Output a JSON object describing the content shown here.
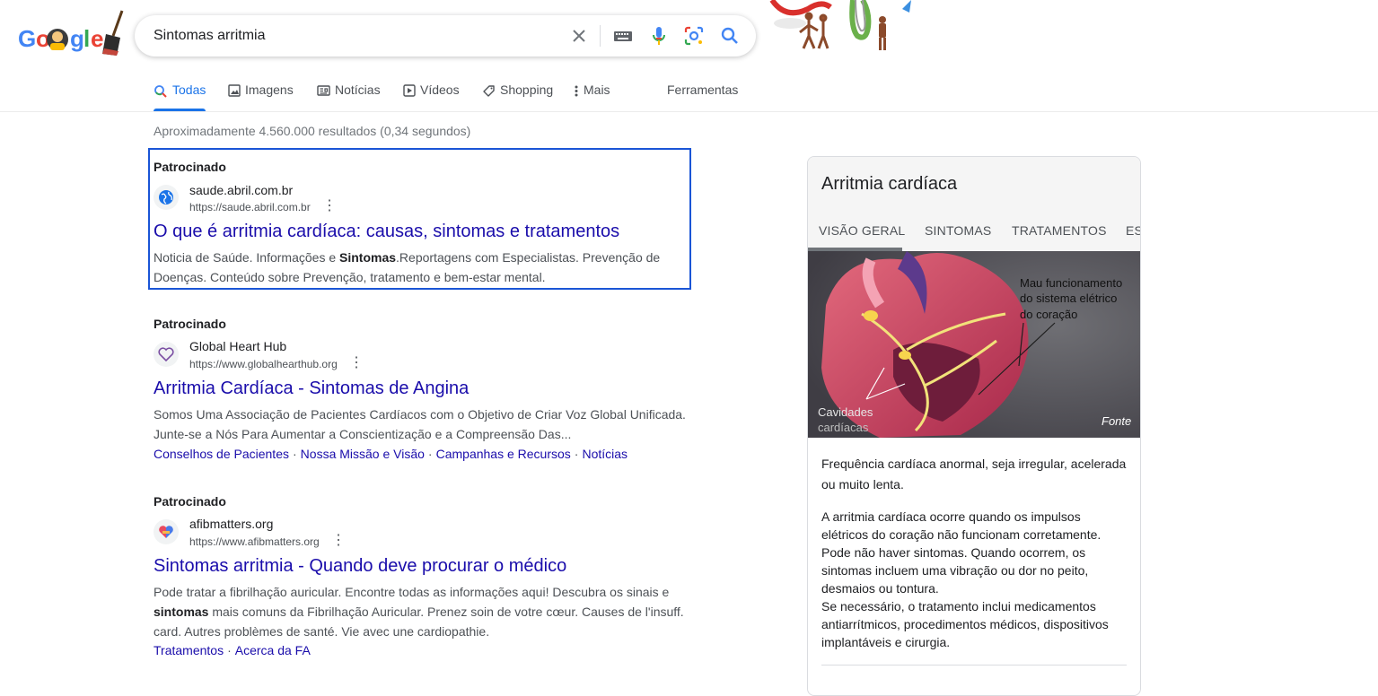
{
  "search": {
    "query": "Sintomas arritmia"
  },
  "logo": {
    "letters": [
      "G",
      "o",
      "o",
      "g",
      "l",
      "e"
    ],
    "colors": [
      "#4285f4",
      "#ea4335",
      "#fbbc05",
      "#4285f4",
      "#34a853",
      "#ea4335"
    ]
  },
  "tabs": [
    {
      "label": "Todas",
      "icon": "search-icon"
    },
    {
      "label": "Imagens",
      "icon": "image-icon"
    },
    {
      "label": "Notícias",
      "icon": "news-icon"
    },
    {
      "label": "Vídeos",
      "icon": "play-icon"
    },
    {
      "label": "Shopping",
      "icon": "tag-icon"
    },
    {
      "label": "Mais",
      "icon": "more-vert-icon"
    }
  ],
  "tools_label": "Ferramentas",
  "result_stats": "Aproximadamente 4.560.000 resultados (0,34 segundos)",
  "ads": [
    {
      "sponsored": "Patrocinado",
      "site_name": "saude.abril.com.br",
      "url": "https://saude.abril.com.br",
      "title": "O que é arritmia cardíaca: causas, sintomas e tratamentos",
      "desc_line1_a": "Noticia de Saúde. Informações e ",
      "desc_line1_b": "Sintomas",
      "desc_line1_c": ".Reportagens com Especialistas. Prevenção de",
      "desc_line2": "Doenças. Conteúdo sobre Prevenção, tratamento e bem-estar mental."
    },
    {
      "sponsored": "Patrocinado",
      "site_name": "Global Heart Hub",
      "url": "https://www.globalhearthub.org",
      "title": "Arritmia Cardíaca - Sintomas de Angina",
      "desc_line1": "Somos Uma Associação de Pacientes Cardíacos com o Objetivo de Criar Voz Global Unificada.",
      "desc_line2": "Junte-se a Nós Para Aumentar a Conscientização e a Compreensão Das...",
      "sitelinks": [
        "Conselhos de Pacientes",
        "Nossa Missão e Visão",
        "Campanhas e Recursos",
        "Notícias"
      ]
    },
    {
      "sponsored": "Patrocinado",
      "site_name": "afibmatters.org",
      "url": "https://www.afibmatters.org",
      "title": "Sintomas arritmia - Quando deve procurar o médico",
      "desc_line1": "Pode tratar a fibrilhação auricular. Encontre todas as informações aqui! Descubra os sinais e",
      "desc_line2_a": "sintomas",
      "desc_line2_b": " mais comuns da Fibrilhação Auricular. Prenez soin de votre cœur. Causes de l'insuff.",
      "desc_line3": "card. Autres problèmes de santé. Vie avec une cardiopathie.",
      "sitelinks": [
        "Tratamentos",
        "Acerca da FA"
      ]
    }
  ],
  "knowledge_panel": {
    "title": "Arritmia cardíaca",
    "tabs": [
      "VISÃO GERAL",
      "SINTOMAS",
      "TRATAMENTOS",
      "ES"
    ],
    "image_caption_lines": [
      "Mau funcionamento",
      "do sistema elétrico",
      "do coração"
    ],
    "image_label_lines": [
      "Cavidades",
      "cardíacas"
    ],
    "image_source": "Fonte",
    "summary_line1": "Frequência cardíaca anormal, seja irregular, acelerada",
    "summary_line2": "ou muito lenta.",
    "body_lines": [
      "A arritmia cardíaca ocorre quando os impulsos",
      "elétricos do coração não funcionam corretamente.",
      "Pode não haver sintomas. Quando ocorrem, os",
      "sintomas incluem uma vibração ou dor no peito,",
      "desmaios ou tontura.",
      "Se necessário, o tratamento inclui medicamentos",
      "antiarrítmicos, procedimentos médicos, dispositivos",
      "implantáveis e cirurgia."
    ]
  }
}
